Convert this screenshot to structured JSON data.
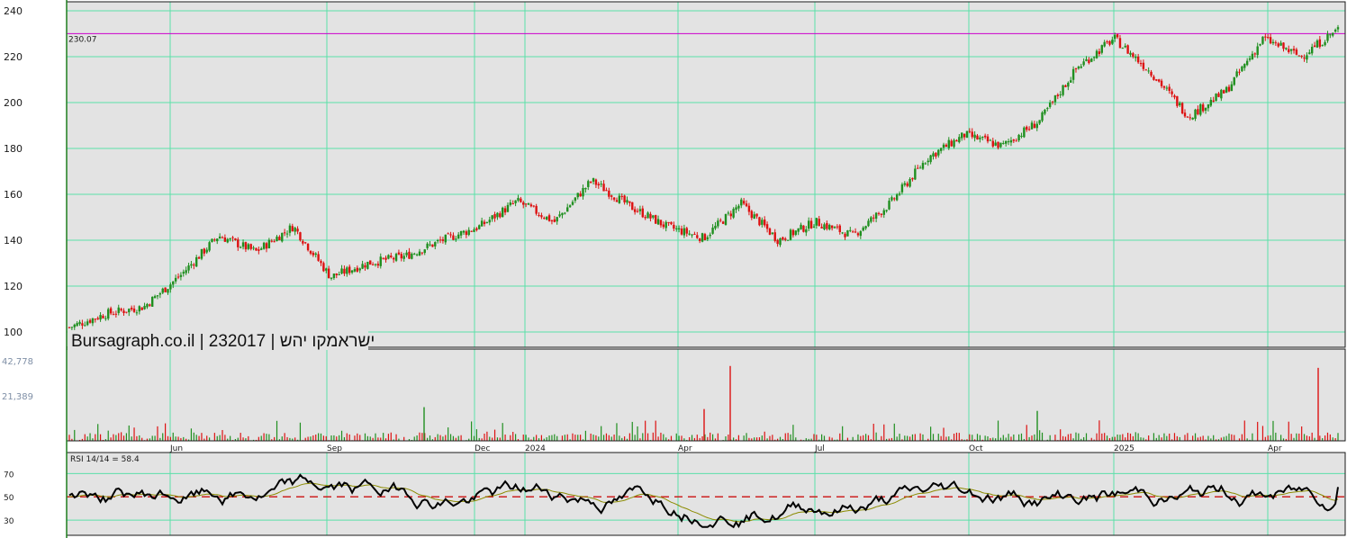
{
  "watermark": "Bursagraph.co.il | 232017 | ישראמקו יהש",
  "chart_data": [
    {
      "type": "candlestick",
      "series_name": "",
      "ylim": [
        95,
        242
      ],
      "y_ticks": [
        100,
        120,
        140,
        160,
        180,
        200,
        220,
        240
      ],
      "y_tick_labels": [
        "100",
        "120",
        "140",
        "160",
        "180",
        "200",
        "220",
        "240"
      ],
      "x_ticks": [
        "Jun",
        "Sep",
        "Dec",
        "2024",
        "Apr",
        "Jul",
        "Oct",
        "2025",
        "Apr"
      ],
      "reference_line": {
        "value": 230.07,
        "label": "230.07",
        "color": "#cc00cc"
      },
      "grid": true,
      "up_color": "#1f8f1f",
      "down_color": "#dd1111",
      "approx_close_path": [
        {
          "month": "May 2023",
          "value": 102
        },
        {
          "month": "Jun 2023",
          "value": 108
        },
        {
          "month": "Jul 2023",
          "value": 111
        },
        {
          "month": "Aug 2023",
          "value": 125
        },
        {
          "month": "Aug 2023",
          "value": 142
        },
        {
          "month": "Sep 2023",
          "value": 135
        },
        {
          "month": "Sep 2023",
          "value": 146
        },
        {
          "month": "Oct 2023",
          "value": 124
        },
        {
          "month": "Nov 2023",
          "value": 130
        },
        {
          "month": "Dec 2023",
          "value": 133
        },
        {
          "month": "Jan 2024",
          "value": 140
        },
        {
          "month": "Feb 2024",
          "value": 146
        },
        {
          "month": "Feb 2024",
          "value": 157
        },
        {
          "month": "Mar 2024",
          "value": 148
        },
        {
          "month": "Mar 2024",
          "value": 166
        },
        {
          "month": "Apr 2024",
          "value": 155
        },
        {
          "month": "May 2024",
          "value": 146
        },
        {
          "month": "Jun 2024",
          "value": 141
        },
        {
          "month": "Jul 2024",
          "value": 156
        },
        {
          "month": "Jul 2024",
          "value": 140
        },
        {
          "month": "Aug 2024",
          "value": 148
        },
        {
          "month": "Sep 2024",
          "value": 142
        },
        {
          "month": "Oct 2024",
          "value": 156
        },
        {
          "month": "Oct 2024",
          "value": 176
        },
        {
          "month": "Nov 2024",
          "value": 186
        },
        {
          "month": "Dec 2024",
          "value": 181
        },
        {
          "month": "Jan 2025",
          "value": 192
        },
        {
          "month": "Feb 2025",
          "value": 215
        },
        {
          "month": "Feb 2025",
          "value": 228
        },
        {
          "month": "Mar 2025",
          "value": 213
        },
        {
          "month": "Mar 2025",
          "value": 194
        },
        {
          "month": "Apr 2025",
          "value": 205
        },
        {
          "month": "Apr 2025",
          "value": 228
        },
        {
          "month": "May 2025",
          "value": 220
        },
        {
          "month": "May 2025",
          "value": 232
        }
      ]
    },
    {
      "type": "bar",
      "panel": "volume",
      "y_tick_labels": [
        "42,778",
        "21,389"
      ],
      "ylim": [
        0,
        42778
      ],
      "notable_spikes": [
        {
          "month": "Oct 2023",
          "value": 18000
        },
        {
          "month": "Apr 2024",
          "value": 17000
        },
        {
          "month": "May 2024",
          "value": 40000
        },
        {
          "month": "Nov 2024",
          "value": 16000
        },
        {
          "month": "May 2025",
          "value": 39000
        }
      ]
    },
    {
      "type": "line",
      "panel": "rsi",
      "label": "RSI 14/14 = 58.4",
      "ylim": [
        20,
        85
      ],
      "y_tick_labels": [
        "70",
        "50",
        "30"
      ],
      "reference_line": {
        "value": 50,
        "style": "dashed",
        "color": "#cc1111"
      },
      "series": [
        {
          "name": "RSI 14",
          "color": "#000000",
          "last": 58.4
        },
        {
          "name": "MA 14",
          "color": "#8b8b00"
        }
      ]
    }
  ]
}
